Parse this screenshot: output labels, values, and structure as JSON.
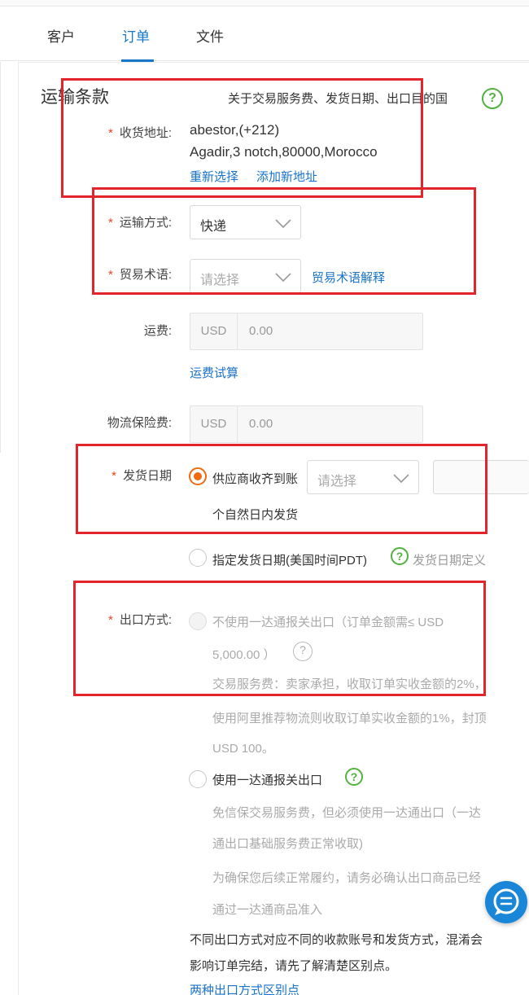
{
  "tabs": [
    {
      "label": "客户"
    },
    {
      "label": "订单"
    },
    {
      "label": "文件"
    }
  ],
  "section": {
    "title": "运输条款",
    "hint": "关于交易服务费、发货日期、出口目的国",
    "help_icon": "?"
  },
  "address": {
    "label": "收货地址:",
    "line1": "abestor,(+212)",
    "line2": "Agadir,3 notch,80000,Morocco",
    "reselect": "重新选择",
    "add_new": "添加新地址"
  },
  "shipping_method": {
    "label": "运输方式:",
    "value": "快递"
  },
  "trade_terms": {
    "label": "贸易术语:",
    "placeholder": "请选择",
    "explain_link": "贸易术语解释"
  },
  "freight": {
    "label": "运费:",
    "currency": "USD",
    "amount": "0.00",
    "calc_link": "运费试算"
  },
  "insurance": {
    "label": "物流保险费:",
    "currency": "USD",
    "amount": "0.00"
  },
  "ship_date": {
    "label": "发货日期",
    "option1_text": "供应商收齐到账",
    "option1_placeholder": "请选择",
    "option1_suffix": "个自然日内发货",
    "option2_text": "指定发货日期(美国时间PDT)",
    "definition_link": "发货日期定义"
  },
  "export": {
    "label": "出口方式:",
    "option1_line1": "不使用一达通报关出口（订单金额需≤ USD",
    "option1_line2": "5,000.00 ）",
    "option1_desc1": "交易服务费：卖家承担，收取订单实收金额的2%，",
    "option1_desc2": "使用阿里推荐物流则收取订单实收金额的1%，封顶",
    "option1_desc3": "USD 100。",
    "option2_text": "使用一达通报关出口",
    "option2_desc1": "免信保交易服务费，但必须使用一达通出口（一达",
    "option2_desc2": "通出口基础服务费正常收取)",
    "option2_desc3": "为确保您后续正常履约，请务必确认出口商品已经",
    "option2_desc4": "通过一达通商品准入",
    "note1": "不同出口方式对应不同的收款账号和发货方式，混淆会",
    "note2": "影响订单完结，请先了解清楚区别点。",
    "diff_link": "两种出口方式区别点"
  },
  "required_mark": "*",
  "colors": {
    "accent": "#1677c9",
    "radio": "#f06b12",
    "highlight": "#e3242b",
    "help": "#52b23e"
  }
}
